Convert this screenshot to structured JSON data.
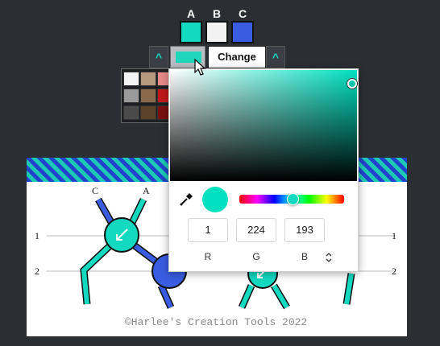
{
  "slots": [
    {
      "label": "A",
      "color": "#14d9c1"
    },
    {
      "label": "B",
      "color": "#f2f2f2"
    },
    {
      "label": "C",
      "color": "#3a5ce0"
    }
  ],
  "toolbar": {
    "up_left": "^",
    "up_right": "^",
    "change_label": "Change",
    "current_color": "#1fd6bd"
  },
  "palette": [
    [
      "#f4f4f4",
      "#b59a7e",
      "#e88a8a"
    ],
    [
      "#9a9a9a",
      "#8b6a4c",
      "#c21a1a"
    ],
    [
      "#4a4a4a",
      "#5b4228",
      "#7a1010"
    ]
  ],
  "diagram": {
    "left_numbers": [
      "1",
      "2"
    ],
    "right_numbers": [
      "1",
      "2"
    ],
    "strand_labels": [
      "C",
      "A"
    ],
    "copyright": "©Harlee's Creation Tools 2022"
  },
  "picker": {
    "r": "1",
    "g": "224",
    "b": "193",
    "r_label": "R",
    "g_label": "G",
    "b_label": "B",
    "preview": "#01e0c1"
  }
}
